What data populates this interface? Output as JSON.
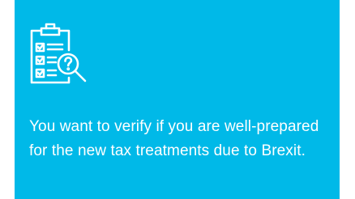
{
  "card": {
    "background_color": "#00b9e8",
    "icon": "checklist-search-icon",
    "message": "You want to verify if you are well-prepared for the new tax treatments due to Brexit."
  }
}
